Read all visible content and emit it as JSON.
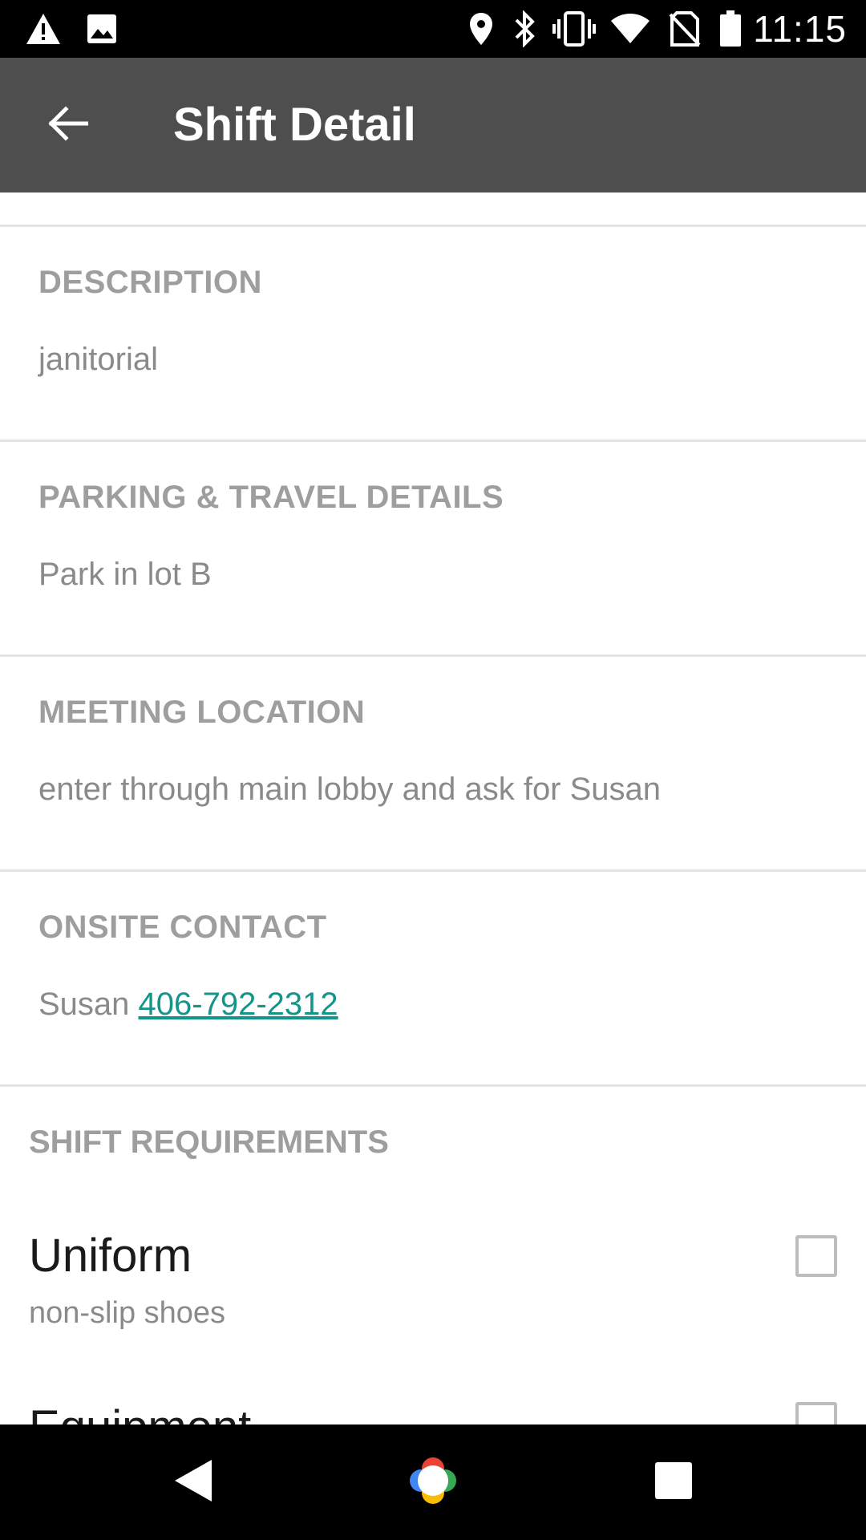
{
  "status_bar": {
    "time": "11:15",
    "left_icons": [
      "warning-icon",
      "image-icon"
    ],
    "right_icons": [
      "location-icon",
      "bluetooth-icon",
      "vibrate-icon",
      "wifi-icon",
      "no-sim-icon",
      "battery-icon"
    ]
  },
  "app_bar": {
    "title": "Shift Detail",
    "back_icon": "arrow-back-icon"
  },
  "sections": [
    {
      "label": "DESCRIPTION",
      "value": "janitorial"
    },
    {
      "label": "PARKING & TRAVEL DETAILS",
      "value": "Park in lot B"
    },
    {
      "label": "MEETING LOCATION",
      "value": "enter through main lobby and ask for Susan"
    },
    {
      "label": "ONSITE CONTACT",
      "value": "Susan",
      "phone": "406-792-2312"
    }
  ],
  "requirements": {
    "header": "SHIFT REQUIREMENTS",
    "items": [
      {
        "title": "Uniform",
        "subtitle": "non-slip shoes",
        "checked": false
      },
      {
        "title": "Equipment",
        "subtitle": "",
        "checked": false
      }
    ]
  },
  "nav_bar": {
    "icons": [
      "nav-back-icon",
      "nav-home-icon",
      "nav-recents-icon"
    ]
  },
  "colors": {
    "status_bar": "#000000",
    "app_bar": "#4e4e4e",
    "label_gray": "#9e9e9e",
    "value_gray": "#8a8a8a",
    "link": "#13958a",
    "divider": "#e3e3e3"
  }
}
